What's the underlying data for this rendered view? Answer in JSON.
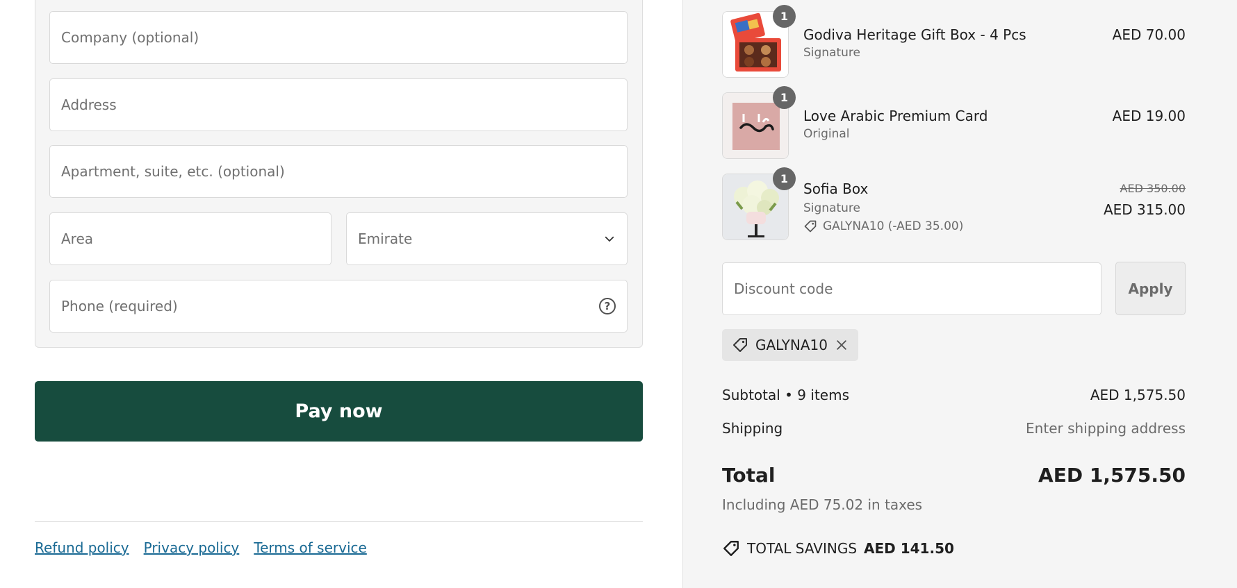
{
  "form": {
    "company_placeholder": "Company (optional)",
    "address_placeholder": "Address",
    "apartment_placeholder": "Apartment, suite, etc. (optional)",
    "area_placeholder": "Area",
    "emirate_placeholder": "Emirate",
    "phone_placeholder": "Phone (required)",
    "pay_label": "Pay now"
  },
  "footer": {
    "links": [
      "Refund policy",
      "Privacy policy",
      "Terms of service"
    ]
  },
  "summary": {
    "items": [
      {
        "qty": "1",
        "name": "Godiva Heritage Gift Box - 4 Pcs",
        "variant": "Signature",
        "price": "AED 70.00"
      },
      {
        "qty": "1",
        "name": "Love Arabic Premium Card",
        "variant": "Original",
        "price": "AED 19.00"
      },
      {
        "qty": "1",
        "name": "Sofia Box",
        "variant": "Signature",
        "original_price": "AED 350.00",
        "price": "AED 315.00",
        "discount": "GALYNA10 (-AED 35.00)"
      }
    ],
    "discount_placeholder": "Discount code",
    "apply_label": "Apply",
    "applied_code": "GALYNA10",
    "subtotal_label": "Subtotal • 9 items",
    "subtotal_value": "AED 1,575.50",
    "shipping_label": "Shipping",
    "shipping_value": "Enter shipping address",
    "total_label": "Total",
    "total_value": "AED 1,575.50",
    "taxes_note": "Including AED 75.02 in taxes",
    "savings_label": "TOTAL SAVINGS",
    "savings_value": "AED 141.50"
  },
  "colors": {
    "pay_button": "#174c3e",
    "link": "#1a6a94",
    "summary_bg": "#f5f5f5"
  }
}
